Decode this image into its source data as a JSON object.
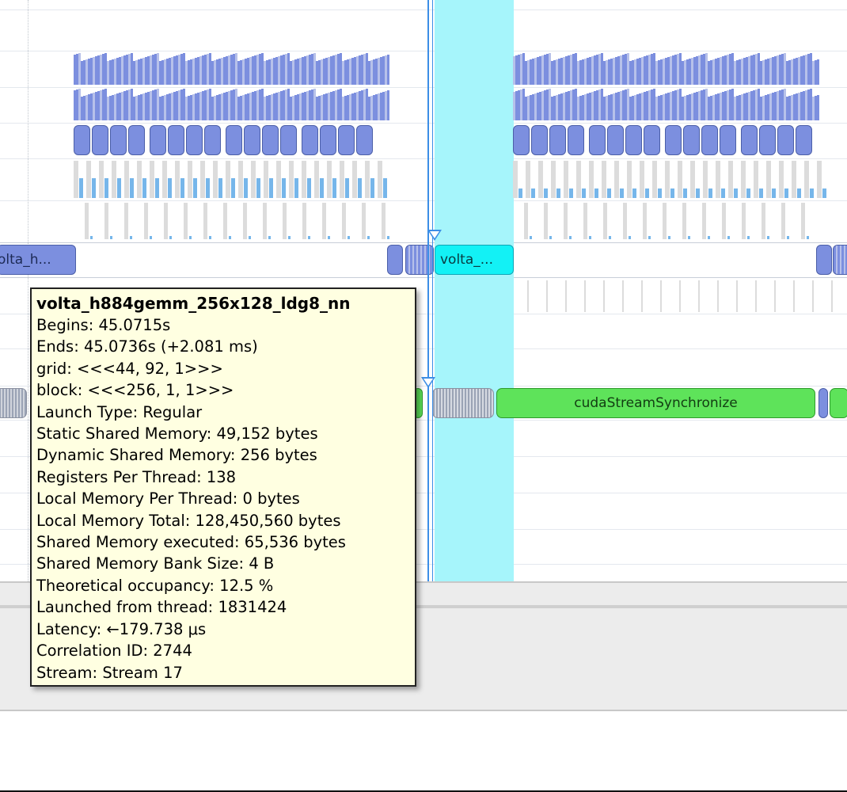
{
  "timeline": {
    "kernel_rows": [
      {
        "label": "olta_h...",
        "selected": false
      },
      {
        "label": "volta_...",
        "selected": true
      }
    ],
    "api_label": "cudaStreamSynchronize",
    "colors": {
      "kernel": "#7c8fdf",
      "kernel_selected": "#13f1f5",
      "api": "#5ee35a",
      "selection_region": "#a6f5fb",
      "cursor": "#3c8ee6"
    }
  },
  "tooltip": {
    "title": "volta_h884gemm_256x128_ldg8_nn",
    "lines": [
      "Begins: 45.0715s",
      "Ends: 45.0736s (+2.081 ms)",
      "grid:  <<<44, 92, 1>>>",
      "block: <<<256, 1, 1>>>",
      "Launch Type: Regular",
      "Static Shared Memory: 49,152 bytes",
      "Dynamic Shared Memory: 256 bytes",
      "Registers Per Thread: 138",
      "Local Memory Per Thread: 0 bytes",
      "Local Memory Total: 128,450,560 bytes",
      "Shared Memory executed: 65,536 bytes",
      "Shared Memory Bank Size: 4 B",
      "Theoretical occupancy: 12.5 %",
      "Launched from thread: 1831424",
      "Latency: ←179.738 μs",
      "Correlation ID: 2744",
      "Stream: Stream 17"
    ]
  }
}
